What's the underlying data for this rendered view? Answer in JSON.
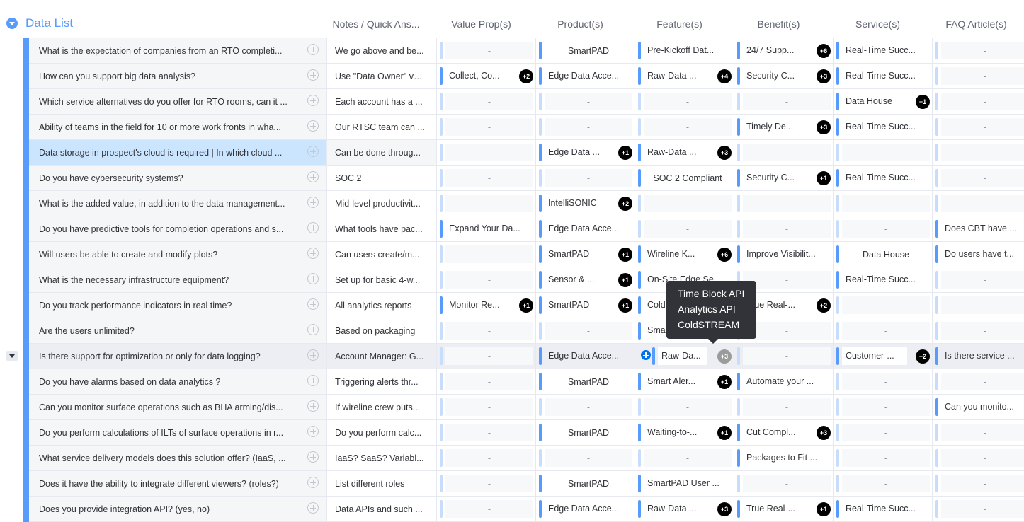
{
  "group": {
    "title": "Data List"
  },
  "columns": [
    "Notes / Quick Ans...",
    "Value Prop(s)",
    "Product(s)",
    "Feature(s)",
    "Benefit(s)",
    "Service(s)",
    "FAQ Article(s)"
  ],
  "rows": [
    {
      "name": "What is the expectation of companies from an RTO completi...",
      "notes": "We go above and be...",
      "cells": [
        {
          "t": "-"
        },
        {
          "t": "SmartPAD",
          "s": "full"
        },
        {
          "t": "Pre-Kickoff Dat...",
          "s": "left"
        },
        {
          "t": "24/7 Supp...",
          "b": "+6"
        },
        {
          "t": "Real-Time Succ...",
          "s": "left"
        },
        {
          "t": "-"
        }
      ]
    },
    {
      "name": "How can you support big data analysis?",
      "notes": "Use \"Data Owner\" va...",
      "cells": [
        {
          "t": "Collect, Co...",
          "b": "+2"
        },
        {
          "t": "Edge Data Acce...",
          "s": "left"
        },
        {
          "t": "Raw-Data ...",
          "b": "+4"
        },
        {
          "t": "Security C...",
          "b": "+3"
        },
        {
          "t": "Real-Time Succ...",
          "s": "left"
        },
        {
          "t": "-"
        }
      ]
    },
    {
      "name": "Which service alternatives do you offer for RTO rooms, can it ...",
      "notes": "Each account has a ...",
      "cells": [
        {
          "t": "-"
        },
        {
          "t": "-"
        },
        {
          "t": "-"
        },
        {
          "t": "-"
        },
        {
          "t": "Data House",
          "b": "+1"
        },
        {
          "t": "-"
        }
      ]
    },
    {
      "name": "Ability of teams in the field for 10 or more work fronts in wha...",
      "notes": "Our RTSC team can ...",
      "cells": [
        {
          "t": "-"
        },
        {
          "t": "-"
        },
        {
          "t": "-"
        },
        {
          "t": "Timely De...",
          "b": "+3"
        },
        {
          "t": "Real-Time Succ...",
          "s": "left"
        },
        {
          "t": "-"
        }
      ]
    },
    {
      "name": "Data storage in prospect's cloud is required | In which cloud ...",
      "notes": "Can be done throug...",
      "selected": true,
      "cells": [
        {
          "t": "-"
        },
        {
          "t": "Edge Data ...",
          "b": "+1"
        },
        {
          "t": "Raw-Data ...",
          "b": "+3"
        },
        {
          "t": "-"
        },
        {
          "t": "-"
        },
        {
          "t": "-"
        }
      ]
    },
    {
      "name": "Do you have cybersecurity systems?",
      "notes": "SOC 2",
      "cells": [
        {
          "t": "-"
        },
        {
          "t": "-"
        },
        {
          "t": "SOC 2 Compliant",
          "s": "full"
        },
        {
          "t": "Security C...",
          "b": "+1"
        },
        {
          "t": "Real-Time Succ...",
          "s": "left"
        },
        {
          "t": "-"
        }
      ]
    },
    {
      "name": "What is the added value, in addition to the data management...",
      "notes": "Mid-level productivit...",
      "cells": [
        {
          "t": "-"
        },
        {
          "t": "IntelliSONIC",
          "b": "+2"
        },
        {
          "t": "-"
        },
        {
          "t": "-"
        },
        {
          "t": "-"
        },
        {
          "t": "-"
        }
      ]
    },
    {
      "name": "Do you have predictive tools for completion operations and s...",
      "notes": "What tools have pac...",
      "cells": [
        {
          "t": "Expand Your Da...",
          "s": "left"
        },
        {
          "t": "Edge Data Acce...",
          "s": "left"
        },
        {
          "t": "-"
        },
        {
          "t": "-"
        },
        {
          "t": "-"
        },
        {
          "t": "Does CBT have ...",
          "s": "left"
        }
      ]
    },
    {
      "name": "Will users be able to create and modify plots?",
      "notes": "Can users create/m...",
      "cells": [
        {
          "t": "-"
        },
        {
          "t": "SmartPAD",
          "b": "+1"
        },
        {
          "t": "Wireline K...",
          "b": "+6"
        },
        {
          "t": "Improve Visibilit...",
          "s": "left"
        },
        {
          "t": "Data House",
          "s": "full"
        },
        {
          "t": "Do users have t...",
          "s": "left"
        }
      ]
    },
    {
      "name": "What is the necessary infrastructure equipment?",
      "notes": "Set up for basic 4-w...",
      "cells": [
        {
          "t": "-"
        },
        {
          "t": "Sensor & ...",
          "b": "+1"
        },
        {
          "t": "On-Site Edge Se...",
          "s": "left"
        },
        {
          "t": "-"
        },
        {
          "t": "Real-Time Succ...",
          "s": "left"
        },
        {
          "t": "-"
        }
      ]
    },
    {
      "name": "Do you track performance indicators in real time?",
      "notes": "All analytics reports",
      "cells": [
        {
          "t": "Monitor Re...",
          "b": "+1"
        },
        {
          "t": "SmartPAD",
          "b": "+1"
        },
        {
          "t": "ColdSTREAM",
          "s": "left"
        },
        {
          "t": "True Real-...",
          "b": "+2"
        },
        {
          "t": "-"
        },
        {
          "t": "-"
        }
      ]
    },
    {
      "name": "Are the users unlimited?",
      "notes": "Based on packaging",
      "cells": [
        {
          "t": "-"
        },
        {
          "t": "-"
        },
        {
          "t": "SmartPAD",
          "s": "left"
        },
        {
          "t": "-"
        },
        {
          "t": "-"
        },
        {
          "t": "-"
        }
      ]
    },
    {
      "name": "Is there support for optimization or only for data logging?",
      "notes": "Account Manager: G...",
      "hover": true,
      "cells": [
        {
          "t": "-"
        },
        {
          "t": "Edge Data Acce...",
          "s": "left"
        },
        {
          "t": "Raw-Da...",
          "b": "+3",
          "gray": true,
          "plus": true
        },
        {
          "t": "-"
        },
        {
          "t": "Customer-...",
          "b": "+2"
        },
        {
          "t": "Is there service ...",
          "s": "left"
        }
      ]
    },
    {
      "name": "Do you have alarms based on data analytics ?",
      "notes": "Triggering alerts thr...",
      "cells": [
        {
          "t": "-"
        },
        {
          "t": "SmartPAD",
          "s": "full"
        },
        {
          "t": "Smart Aler...",
          "b": "+1"
        },
        {
          "t": "Automate your ...",
          "s": "left"
        },
        {
          "t": "-"
        },
        {
          "t": "-"
        }
      ]
    },
    {
      "name": "Can you monitor surface operations such as BHA arming/dis...",
      "notes": "If wireline crew puts...",
      "cells": [
        {
          "t": "-"
        },
        {
          "t": "-"
        },
        {
          "t": "-"
        },
        {
          "t": "-"
        },
        {
          "t": "-"
        },
        {
          "t": "Can you monito...",
          "s": "left"
        }
      ]
    },
    {
      "name": "Do you perform calculations of ILTs of surface operations in r...",
      "notes": "Do you perform calc...",
      "cells": [
        {
          "t": "-"
        },
        {
          "t": "SmartPAD",
          "s": "full"
        },
        {
          "t": "Waiting-to-...",
          "b": "+1"
        },
        {
          "t": "Cut Compl...",
          "b": "+3"
        },
        {
          "t": "-"
        },
        {
          "t": "-"
        }
      ]
    },
    {
      "name": "What service delivery models does this solution offer? (IaaS, ...",
      "notes": "IaaS? SaaS? Variabl...",
      "cells": [
        {
          "t": "-"
        },
        {
          "t": "-"
        },
        {
          "t": "-"
        },
        {
          "t": "Packages to Fit ...",
          "s": "left"
        },
        {
          "t": "-"
        },
        {
          "t": "-"
        }
      ]
    },
    {
      "name": "Does it have the ability to integrate different viewers? (roles?)",
      "notes": "List different roles",
      "cells": [
        {
          "t": "-"
        },
        {
          "t": "SmartPAD",
          "s": "full"
        },
        {
          "t": "SmartPAD User ...",
          "s": "left"
        },
        {
          "t": "-"
        },
        {
          "t": "-"
        },
        {
          "t": "-"
        }
      ]
    },
    {
      "name": "Does you provide integration API? (yes, no)",
      "notes": "Data APIs and such ...",
      "cells": [
        {
          "t": "-"
        },
        {
          "t": "Edge Data Acce...",
          "s": "left"
        },
        {
          "t": "Raw-Data ...",
          "b": "+3"
        },
        {
          "t": "True Real-...",
          "b": "+1"
        },
        {
          "t": "Real-Time Succ...",
          "s": "left"
        },
        {
          "t": "-"
        }
      ]
    }
  ],
  "tooltip": {
    "items": [
      "Time Block API",
      "Analytics API",
      "ColdSTREAM"
    ]
  },
  "colors": {
    "accent": "#579bfc",
    "badge": "#000000",
    "selected_row": "#cce5ff"
  }
}
